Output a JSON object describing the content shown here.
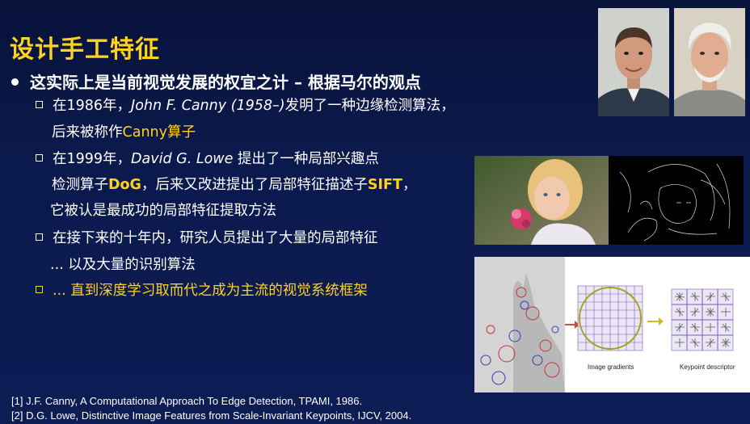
{
  "slide": {
    "title": "设计手工特征",
    "main_bullet": "这实际上是当前视觉发展的权宜之计 – 根据马尔的观点",
    "items": [
      {
        "line1_a": "在1986年，",
        "line1_name": "John F. Canny (1958–)",
        "line1_b": "发明了一种边缘检测算法，",
        "line2_a": "后来被称作",
        "line2_hl": "Canny算子"
      },
      {
        "line1_a": "在1999年，",
        "line1_name": "David G. Lowe",
        "line1_b": " 提出了一种局部兴趣点",
        "line2_a": "检测算子",
        "line2_hl1": "DoG",
        "line2_b": "，后来又改进提出了局部特征描述子",
        "line2_hl2": "SIFT",
        "line2_c": "，",
        "line3": "它被认是最成功的局部特征提取方法"
      },
      {
        "line1": "在接下来的十年内，研究人员提出了大量的局部特征",
        "line2": "... 以及大量的识别算法"
      },
      {
        "line1": "... 直到深度学习取而代之成为主流的视觉系统框架"
      }
    ],
    "references": [
      "[1] J.F. Canny, A Computational Approach To Edge Detection, TPAMI, 1986.",
      "[2] D.G. Lowe, Distinctive Image Features from Scale-Invariant Keypoints, IJCV, 2004."
    ],
    "figure": {
      "caption_gradients": "Image gradients",
      "caption_descriptor": "Keypoint descriptor"
    }
  },
  "colors": {
    "background": "#0b1a4d",
    "title": "#ffd21f",
    "highlight": "#ffd21f",
    "text": "#ffffff",
    "grid": "#7b5bb5",
    "arrow_red": "#d9453a",
    "arrow_yellow": "#c8c01c"
  },
  "icons": {
    "main_bullet": "filled-circle-bullet",
    "sub_bullet": "hollow-square-bullet"
  }
}
